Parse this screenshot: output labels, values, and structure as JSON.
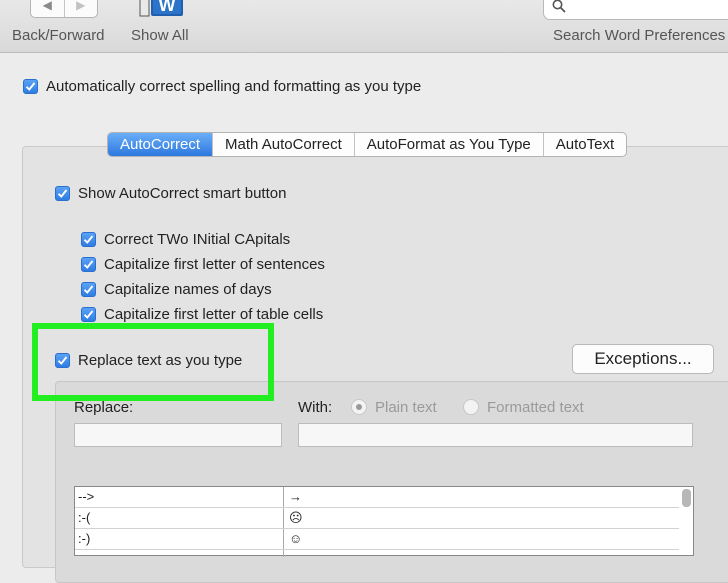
{
  "toolbar": {
    "back_forward_label": "Back/Forward",
    "show_all_label": "Show All",
    "search_placeholder": "Search Word Preferences",
    "back_icon": "◀",
    "forward_icon": "▶"
  },
  "options": {
    "auto_correct_as_you_type": "Automatically correct spelling and formatting as you type",
    "show_smart_button": "Show AutoCorrect smart button",
    "correct_two_initial_caps": "Correct TWo INitial CApitals",
    "capitalize_sentences": "Capitalize first letter of sentences",
    "capitalize_days": "Capitalize names of days",
    "capitalize_table_cells": "Capitalize first letter of table cells",
    "replace_text": "Replace text as you type"
  },
  "tabs": [
    "AutoCorrect",
    "Math AutoCorrect",
    "AutoFormat as You Type",
    "AutoText"
  ],
  "active_tab": "AutoCorrect",
  "exceptions_label": "Exceptions...",
  "replace_section": {
    "replace_label": "Replace:",
    "with_label": "With:",
    "plain_text_label": "Plain text",
    "formatted_text_label": "Formatted text"
  },
  "table_rows": [
    {
      "replace": "-->",
      "with": "→"
    },
    {
      "replace": ":-(",
      "with": "☹"
    },
    {
      "replace": ":-)",
      "with": "☺"
    }
  ],
  "colors": {
    "accent_blue": "#2f7de1",
    "highlight_green": "#22ee22"
  },
  "icons": {
    "show_all": "word-app-icon",
    "search": "magnifier-icon",
    "checkbox": "checkmark-icon"
  }
}
